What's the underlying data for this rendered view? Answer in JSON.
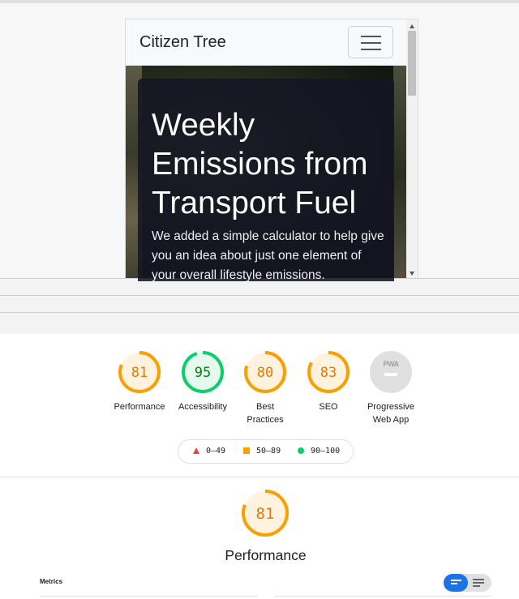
{
  "website": {
    "brand": "Citizen Tree",
    "hero_title": "Weekly Emissions from Transport Fuel",
    "hero_text": "We added a simple calculator to help give you an idea about just one element of your overall lifestyle emissions."
  },
  "report": {
    "categories": [
      {
        "label": "Performance",
        "score": "81",
        "color": "#fa9f00",
        "text_color": "#e67700",
        "fraction": 0.81
      },
      {
        "label": "Accessibility",
        "score": "95",
        "color": "#0cce6b",
        "text_color": "#008800",
        "fraction": 0.95
      },
      {
        "label": "Best Practices",
        "score": "80",
        "color": "#fa9f00",
        "text_color": "#e67700",
        "fraction": 0.8
      },
      {
        "label": "SEO",
        "score": "83",
        "color": "#fa9f00",
        "text_color": "#e67700",
        "fraction": 0.83
      },
      {
        "label": "Progressive Web App",
        "badge": "PWA"
      }
    ],
    "legend": {
      "fail": "0–49",
      "average": "50–89",
      "pass": "90–100"
    },
    "performance_section": {
      "score": "81",
      "fraction": 0.81,
      "title": "Performance",
      "metrics_label": "Metrics"
    }
  }
}
